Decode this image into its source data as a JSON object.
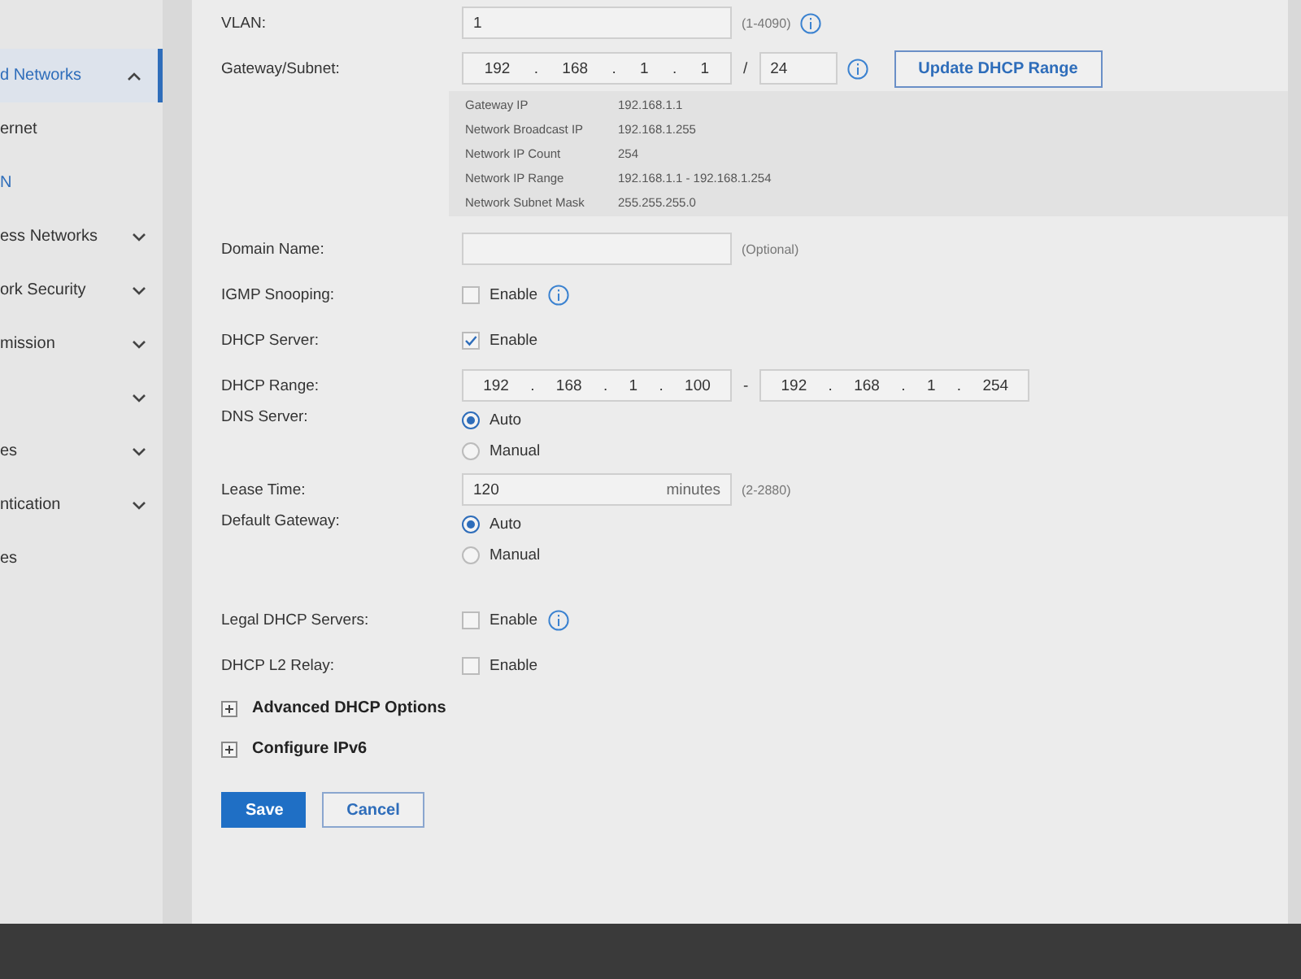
{
  "sidebar": {
    "items": [
      {
        "label": "d Networks",
        "expanded": true,
        "children": [
          {
            "label": "ernet",
            "selected": false
          },
          {
            "label": "N",
            "selected": true
          }
        ]
      },
      {
        "label": "ess Networks",
        "expanded": false
      },
      {
        "label": "ork Security",
        "expanded": false
      },
      {
        "label": "mission",
        "expanded": false
      },
      {
        "expanded": false
      },
      {
        "label": "es",
        "expanded": false
      },
      {
        "label": "ntication",
        "expanded": false
      },
      {
        "label": "es"
      }
    ]
  },
  "form": {
    "rows": [
      {
        "kind": "text",
        "label": "VLAN:",
        "value": "1",
        "hint": "(1-4090)",
        "info": true
      },
      {
        "kind": "subnet",
        "label": "Gateway/Subnet:",
        "octets": [
          "192",
          "168",
          "1",
          "1"
        ],
        "dot": ".",
        "slash": "/",
        "prefix": "24",
        "info": true,
        "button": "Update DHCP Range"
      },
      {
        "kind": "summary",
        "items": [
          {
            "label": "Gateway IP",
            "value": "192.168.1.1"
          },
          {
            "label": "Network Broadcast IP",
            "value": "192.168.1.255"
          },
          {
            "label": "Network IP Count",
            "value": "254"
          },
          {
            "label": "Network IP Range",
            "value": "192.168.1.1 - 192.168.1.254"
          },
          {
            "label": "Network Subnet Mask",
            "value": "255.255.255.0"
          }
        ]
      },
      {
        "kind": "text",
        "label": "Domain Name:",
        "hint": "(Optional)"
      },
      {
        "kind": "checkbox",
        "label": "IGMP Snooping:",
        "option": "Enable",
        "checked": false,
        "info": true
      },
      {
        "kind": "checkbox",
        "label": "DHCP Server:",
        "option": "Enable",
        "checked": true
      },
      {
        "kind": "range",
        "label": "DHCP Range:",
        "start": [
          "192",
          "168",
          "1",
          "100"
        ],
        "dot": ".",
        "separator": "-",
        "end": [
          "192",
          "168",
          "1",
          "254"
        ]
      },
      {
        "kind": "radio",
        "label": "DNS Server:",
        "options": [
          {
            "label": "Auto",
            "selected": true
          },
          {
            "label": "Manual",
            "selected": false
          }
        ]
      },
      {
        "kind": "text",
        "label": "Lease Time:",
        "value": "120",
        "unit": "minutes",
        "hint": "(2-2880)"
      },
      {
        "kind": "radio",
        "label": "Default Gateway:",
        "options": [
          {
            "label": "Auto",
            "selected": true
          },
          {
            "label": "Manual",
            "selected": false
          }
        ]
      },
      {
        "kind": "checkbox",
        "label": "Legal DHCP Servers:",
        "option": "Enable",
        "checked": false,
        "info": true
      },
      {
        "kind": "checkbox",
        "label": "DHCP L2 Relay:",
        "option": "Enable",
        "checked": false
      },
      {
        "kind": "section",
        "label": "Advanced DHCP Options",
        "expanded": false
      },
      {
        "kind": "section",
        "label": "Configure IPv6",
        "expanded": false
      }
    ],
    "buttons": [
      {
        "label": "Save",
        "kind": "primary"
      },
      {
        "label": "Cancel",
        "kind": "secondary"
      }
    ]
  }
}
